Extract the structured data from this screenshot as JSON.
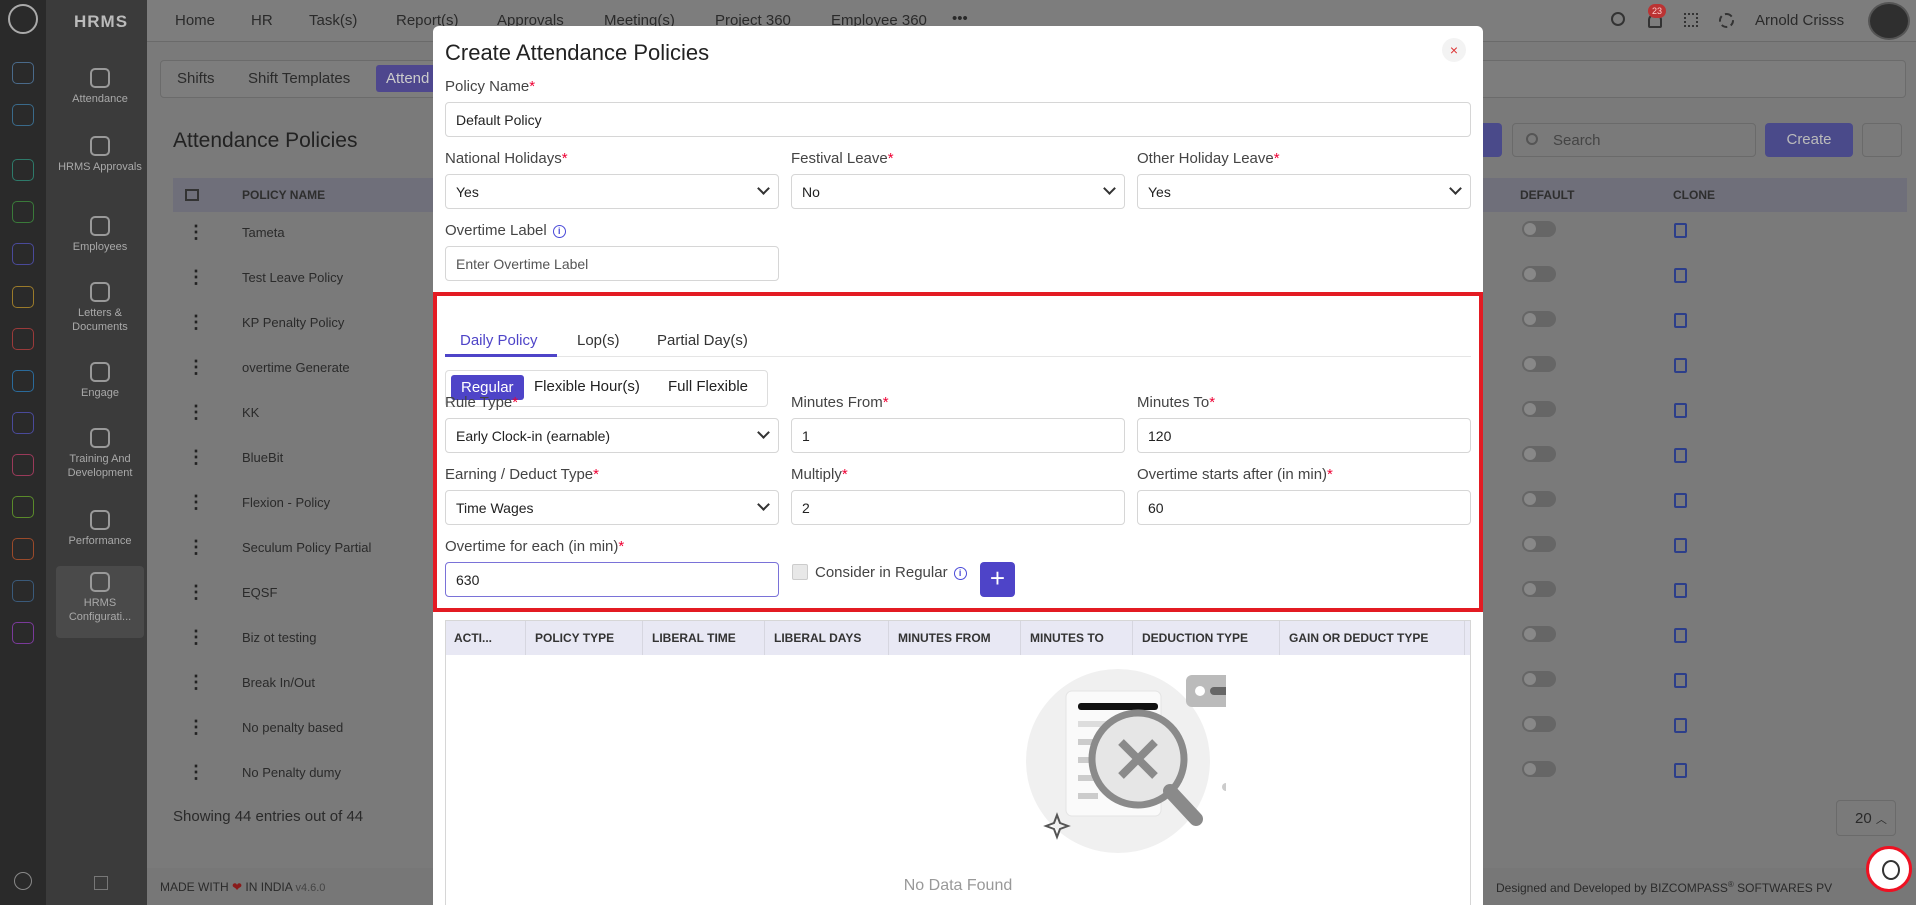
{
  "app": {
    "brand": "HRMS"
  },
  "topnav": {
    "items": [
      "Home",
      "HR",
      "Task(s)",
      "Report(s)",
      "Approvals",
      "Meeting(s)",
      "Project 360",
      "Employee 360"
    ],
    "more": "•••",
    "notification_count": "23",
    "user_name": "Arnold Crisss"
  },
  "sidebar": {
    "items": [
      "Attendance",
      "HRMS Approvals",
      "Employees",
      "Letters & Documents",
      "Engage",
      "Training And Development",
      "Performance",
      "HRMS Configurati..."
    ]
  },
  "page_tabs": [
    "Shifts",
    "Shift Templates",
    "Attend"
  ],
  "page": {
    "title": "Attendance Policies",
    "search_placeholder": "Search",
    "create_label": "Create",
    "columns": {
      "policy_name": "POLICY NAME",
      "default": "DEFAULT",
      "clone": "CLONE"
    },
    "rows": [
      "Tameta",
      "Test Leave Policy",
      "KP Penalty Policy",
      "overtime Generate",
      "KK",
      "BlueBit",
      "Flexion - Policy",
      "Seculum Policy Partial",
      "EQSF",
      "Biz ot testing",
      "Break In/Out",
      "No penalty based",
      "No Penalty dumy"
    ],
    "showing": "Showing 44 entries out of 44",
    "page_size": "20"
  },
  "footer": {
    "made_with": "MADE WITH",
    "heart": "❤",
    "in_india": "IN INDIA",
    "version": "v4.6.0",
    "designed": "Designed and Developed by",
    "company": "BIZCOMPASS",
    "reg": "®",
    "company_tail": "SOFTWARES PV"
  },
  "modal": {
    "title": "Create Attendance Policies",
    "close": "×",
    "policy_name_label": "Policy Name",
    "policy_name_value": "Default Policy",
    "national_holidays_label": "National Holidays",
    "national_holidays_value": "Yes",
    "festival_leave_label": "Festival Leave",
    "festival_leave_value": "No",
    "other_holiday_label": "Other Holiday Leave",
    "other_holiday_value": "Yes",
    "overtime_label_label": "Overtime Label",
    "overtime_label_placeholder": "Enter Overtime Label",
    "required_mark": "*",
    "info_glyph": "i",
    "tabs": [
      "Daily Policy",
      "Lop(s)",
      "Partial Day(s)"
    ],
    "segments": [
      "Regular",
      "Flexible Hour(s)",
      "Full Flexible"
    ],
    "rule_type_label": "Rule Type",
    "rule_type_value": "Early Clock-in (earnable)",
    "minutes_from_label": "Minutes From",
    "minutes_from_value": "1",
    "minutes_to_label": "Minutes To",
    "minutes_to_value": "120",
    "earning_label": "Earning / Deduct Type",
    "earning_value": "Time Wages",
    "multiply_label": "Multiply",
    "multiply_value": "2",
    "ot_after_label": "Overtime starts after (in min)",
    "ot_after_value": "60",
    "ot_each_label": "Overtime for each (in min)",
    "ot_each_value": "630",
    "consider_label": "Consider in Regular",
    "add_label": "+",
    "grid_columns": [
      "ACTI...",
      "POLICY TYPE",
      "LIBERAL TIME",
      "LIBERAL DAYS",
      "MINUTES FROM",
      "MINUTES TO",
      "DEDUCTION TYPE",
      "GAIN OR DEDUCT TYPE"
    ],
    "no_data": "No Data Found"
  },
  "colors": {
    "accent": "#4e44c8",
    "highlight": "#e31b23"
  }
}
